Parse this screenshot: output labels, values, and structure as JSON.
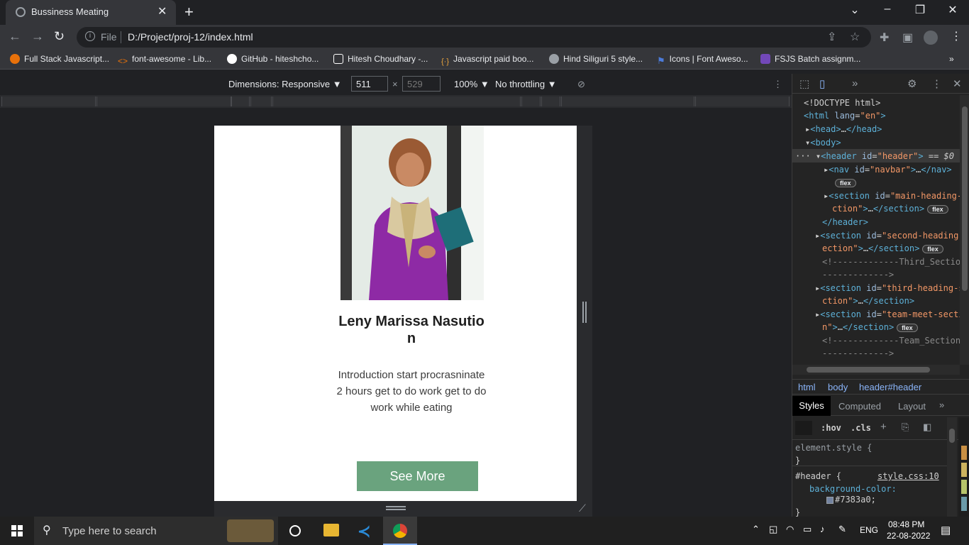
{
  "browser": {
    "tab_title": "Bussiness Meating",
    "url_scheme": "File",
    "url": "D:/Project/proj-12/index.html",
    "bookmarks": [
      {
        "label": "Full Stack Javascript...",
        "icon": "fullstack-icon",
        "color": "#e8710a"
      },
      {
        "label": "font-awesome - Lib...",
        "icon": "code-icon",
        "color": "#e8710a"
      },
      {
        "label": "GitHub - hiteshcho...",
        "icon": "github-icon",
        "color": "#ffffff"
      },
      {
        "label": "Hitesh Choudhary -...",
        "icon": "page-icon",
        "color": "#ffffff"
      },
      {
        "label": "Javascript paid boo...",
        "icon": "js-brackets-icon",
        "color": "#e8a33d"
      },
      {
        "label": "Hind Siliguri 5 style...",
        "icon": "google-fonts-icon",
        "color": "#9aa0a6"
      },
      {
        "label": "Icons | Font Aweso...",
        "icon": "flag-icon",
        "color": "#4c7bd9"
      },
      {
        "label": "FSJS Batch assignm...",
        "icon": "form-icon",
        "color": "#7248b9"
      }
    ]
  },
  "devbar": {
    "dimensions_label": "Dimensions: Responsive",
    "width": "511",
    "height": "529",
    "zoom": "100%",
    "throttling": "No throttling"
  },
  "page": {
    "name": "Leny Marissa Nasution",
    "description": "Introduction start procrasninate 2 hours get to do work get to do work while eating",
    "button_label": "See More",
    "button_color": "#6aa37e"
  },
  "devtools": {
    "breadcrumbs": [
      "html",
      "body",
      "header#header"
    ],
    "styles_tabs": [
      "Styles",
      "Computed",
      "Layout"
    ],
    "filter_buttons": [
      ":hov",
      ".cls"
    ],
    "element_style": "element.style {",
    "close_brace": "}",
    "rule_selector": "#header {",
    "rule_source": "style.css:10",
    "rule_property": "background-color:",
    "rule_value": "#7383a0;",
    "rule_close": "}",
    "swatch_color": "#7383a0"
  },
  "taskbar": {
    "search_placeholder": "Type here to search",
    "language": "ENG",
    "time": "08:48 PM",
    "date": "22-08-2022"
  }
}
